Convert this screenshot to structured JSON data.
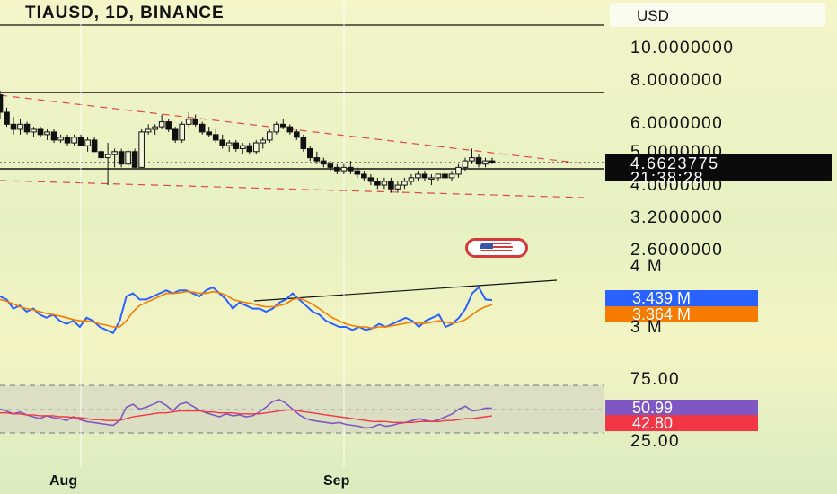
{
  "header": {
    "title": "TIAUSD, 1D, BINANCE",
    "currency": "USD"
  },
  "price_axis": {
    "ticks": [
      "10.0000000",
      "8.0000000",
      "6.0000000",
      "5.0000000",
      "4.0000000",
      "3.2000000",
      "2.6000000"
    ],
    "last_price": "4.6623775",
    "countdown": "21:38:28"
  },
  "volume_axis": {
    "ticks": [
      "4 M",
      "3 M"
    ],
    "tag1": "3.439 M",
    "tag2": "3.364 M"
  },
  "rsi_axis": {
    "ticks": [
      "75.00",
      "25.00"
    ],
    "tag1": "50.99",
    "tag2": "42.80"
  },
  "time_axis": {
    "labels": [
      "Aug",
      "Sep"
    ]
  },
  "colors": {
    "blue_series": "#2962ff",
    "orange_series": "#f57c00",
    "purple_series": "#7e57c2",
    "red_series": "#f23645",
    "channel": "#e04848"
  },
  "icons": {
    "flag_badge": "us-flag-icon"
  },
  "chart_data": [
    {
      "type": "candlestick",
      "title": "TIAUSD, 1D, BINANCE",
      "scale": "log",
      "ylim": [
        2.4,
        12
      ],
      "yticks": [
        10,
        8,
        6,
        5,
        4,
        3.2,
        2.6
      ],
      "last": 4.6623775,
      "candles": [
        [
          7.3,
          7.5,
          6.2,
          6.5
        ],
        [
          6.5,
          6.7,
          5.9,
          6.0
        ],
        [
          6.0,
          6.3,
          5.6,
          5.8
        ],
        [
          5.8,
          6.2,
          5.6,
          6.0
        ],
        [
          6.0,
          6.1,
          5.6,
          5.7
        ],
        [
          5.7,
          5.9,
          5.5,
          5.8
        ],
        [
          5.8,
          5.9,
          5.5,
          5.6
        ],
        [
          5.6,
          5.8,
          5.4,
          5.7
        ],
        [
          5.7,
          5.8,
          5.3,
          5.4
        ],
        [
          5.4,
          5.6,
          5.3,
          5.5
        ],
        [
          5.5,
          5.6,
          5.2,
          5.3
        ],
        [
          5.3,
          5.6,
          5.2,
          5.5
        ],
        [
          5.5,
          5.6,
          5.2,
          5.2
        ],
        [
          5.2,
          5.5,
          5.0,
          5.4
        ],
        [
          5.4,
          5.5,
          5.0,
          5.0
        ],
        [
          5.0,
          5.1,
          4.7,
          4.8
        ],
        [
          4.8,
          5.3,
          4.0,
          4.9
        ],
        [
          4.9,
          5.1,
          4.5,
          5.0
        ],
        [
          5.0,
          5.1,
          4.5,
          4.6
        ],
        [
          4.6,
          5.1,
          4.5,
          5.0
        ],
        [
          5.0,
          5.1,
          4.5,
          4.5
        ],
        [
          4.5,
          5.8,
          4.5,
          5.7
        ],
        [
          5.7,
          6.0,
          5.6,
          5.8
        ],
        [
          5.8,
          6.0,
          5.6,
          5.9
        ],
        [
          5.9,
          6.4,
          5.8,
          6.1
        ],
        [
          6.1,
          6.2,
          5.7,
          5.8
        ],
        [
          5.8,
          5.9,
          5.3,
          5.4
        ],
        [
          5.4,
          6.1,
          5.3,
          6.0
        ],
        [
          6.0,
          6.5,
          5.9,
          6.2
        ],
        [
          6.2,
          6.4,
          5.9,
          6.0
        ],
        [
          6.0,
          6.1,
          5.6,
          5.7
        ],
        [
          5.7,
          5.9,
          5.5,
          5.6
        ],
        [
          5.6,
          5.8,
          5.3,
          5.4
        ],
        [
          5.4,
          5.6,
          5.1,
          5.2
        ],
        [
          5.2,
          5.4,
          5.0,
          5.3
        ],
        [
          5.3,
          5.4,
          5.0,
          5.1
        ],
        [
          5.1,
          5.3,
          4.9,
          5.2
        ],
        [
          5.2,
          5.3,
          4.9,
          5.0
        ],
        [
          5.0,
          5.4,
          4.9,
          5.3
        ],
        [
          5.3,
          5.5,
          5.1,
          5.4
        ],
        [
          5.4,
          5.8,
          5.3,
          5.7
        ],
        [
          5.7,
          6.1,
          5.6,
          6.0
        ],
        [
          6.0,
          6.2,
          5.8,
          5.9
        ],
        [
          5.9,
          6.0,
          5.6,
          5.7
        ],
        [
          5.7,
          5.8,
          5.4,
          5.5
        ],
        [
          5.5,
          5.6,
          5.0,
          5.1
        ],
        [
          5.1,
          5.2,
          4.7,
          4.8
        ],
        [
          4.8,
          5.0,
          4.6,
          4.7
        ],
        [
          4.7,
          4.8,
          4.5,
          4.6
        ],
        [
          4.6,
          4.7,
          4.4,
          4.5
        ],
        [
          4.5,
          4.6,
          4.3,
          4.4
        ],
        [
          4.4,
          4.6,
          4.3,
          4.5
        ],
        [
          4.5,
          4.7,
          4.3,
          4.4
        ],
        [
          4.4,
          4.5,
          4.2,
          4.3
        ],
        [
          4.3,
          4.4,
          4.1,
          4.2
        ],
        [
          4.2,
          4.3,
          4.0,
          4.1
        ],
        [
          4.1,
          4.2,
          3.9,
          4.0
        ],
        [
          4.0,
          4.2,
          3.9,
          4.1
        ],
        [
          4.1,
          4.2,
          3.8,
          3.9
        ],
        [
          3.9,
          4.1,
          3.8,
          4.0
        ],
        [
          4.0,
          4.2,
          3.9,
          4.1
        ],
        [
          4.1,
          4.3,
          4.0,
          4.2
        ],
        [
          4.2,
          4.4,
          4.1,
          4.3
        ],
        [
          4.3,
          4.4,
          4.1,
          4.2
        ],
        [
          4.2,
          4.3,
          4.0,
          4.2
        ],
        [
          4.2,
          4.3,
          4.1,
          4.3
        ],
        [
          4.3,
          4.4,
          4.2,
          4.2
        ],
        [
          4.2,
          4.4,
          4.1,
          4.3
        ],
        [
          4.3,
          4.6,
          4.2,
          4.5
        ],
        [
          4.5,
          4.8,
          4.4,
          4.7
        ],
        [
          4.7,
          5.1,
          4.6,
          4.8
        ],
        [
          4.8,
          4.9,
          4.5,
          4.6
        ],
        [
          4.6,
          4.8,
          4.5,
          4.7
        ],
        [
          4.7,
          4.8,
          4.6,
          4.66
        ]
      ],
      "xlabels": [
        "Aug",
        "Sep"
      ]
    },
    {
      "type": "line",
      "panel": "volume oscillator",
      "yticks": [
        "4 M",
        "3 M"
      ],
      "series": [
        {
          "values": [
            3.5,
            3.45,
            3.3,
            3.35,
            3.25,
            3.3,
            3.2,
            3.15,
            3.2,
            3.1,
            3.05,
            3.1,
            3.0,
            3.15,
            3.1,
            3.0,
            2.95,
            2.9,
            3.1,
            3.5,
            3.55,
            3.45,
            3.45,
            3.5,
            3.55,
            3.6,
            3.55,
            3.6,
            3.6,
            3.55,
            3.5,
            3.6,
            3.65,
            3.55,
            3.45,
            3.3,
            3.4,
            3.35,
            3.3,
            3.3,
            3.25,
            3.3,
            3.4,
            3.45,
            3.55,
            3.45,
            3.35,
            3.25,
            3.2,
            3.1,
            3.05,
            3.0,
            3.0,
            2.95,
            3.0,
            2.95,
            2.98,
            3.05,
            3.0,
            3.05,
            3.1,
            3.15,
            3.1,
            3.0,
            3.1,
            3.15,
            3.2,
            3.0,
            3.05,
            3.15,
            3.3,
            3.55,
            3.65,
            3.45,
            3.44
          ],
          "last": 3.439
        },
        {
          "values": [
            3.45,
            3.42,
            3.38,
            3.33,
            3.3,
            3.28,
            3.25,
            3.22,
            3.2,
            3.18,
            3.15,
            3.12,
            3.1,
            3.1,
            3.08,
            3.05,
            3.03,
            3.0,
            3.0,
            3.1,
            3.25,
            3.35,
            3.4,
            3.45,
            3.5,
            3.55,
            3.55,
            3.56,
            3.58,
            3.57,
            3.55,
            3.55,
            3.58,
            3.56,
            3.52,
            3.45,
            3.42,
            3.4,
            3.38,
            3.35,
            3.33,
            3.33,
            3.35,
            3.38,
            3.45,
            3.47,
            3.43,
            3.37,
            3.3,
            3.22,
            3.15,
            3.1,
            3.05,
            3.02,
            3.0,
            3.0,
            2.98,
            3.0,
            3.0,
            3.02,
            3.04,
            3.06,
            3.08,
            3.06,
            3.06,
            3.08,
            3.1,
            3.08,
            3.06,
            3.08,
            3.12,
            3.2,
            3.28,
            3.33,
            3.364
          ],
          "last": 3.364
        }
      ]
    },
    {
      "type": "line",
      "panel": "RSI",
      "yticks": [
        "75.00",
        "25.00"
      ],
      "ylim": [
        0,
        100
      ],
      "series": [
        {
          "values": [
            50,
            48,
            45,
            47,
            44,
            42,
            40,
            43,
            41,
            40,
            38,
            42,
            39,
            37,
            36,
            35,
            34,
            33,
            38,
            52,
            55,
            50,
            52,
            55,
            58,
            54,
            48,
            55,
            57,
            53,
            49,
            46,
            44,
            42,
            45,
            43,
            44,
            42,
            43,
            47,
            52,
            58,
            60,
            56,
            50,
            44,
            40,
            38,
            37,
            36,
            35,
            36,
            34,
            33,
            32,
            30,
            31,
            34,
            32,
            33,
            35,
            36,
            38,
            40,
            38,
            37,
            39,
            42,
            45,
            50,
            53,
            48,
            49,
            51,
            50.99
          ],
          "last": 50.99
        },
        {
          "values": [
            46,
            46,
            45,
            45,
            44,
            44,
            43,
            43,
            43,
            42,
            42,
            41,
            41,
            40,
            39,
            39,
            38,
            38,
            38,
            40,
            42,
            43,
            44,
            45,
            46,
            46,
            47,
            48,
            48,
            48,
            48,
            47,
            47,
            46,
            46,
            46,
            45,
            45,
            45,
            45,
            46,
            47,
            48,
            49,
            49,
            48,
            47,
            46,
            45,
            44,
            43,
            42,
            41,
            40,
            39,
            38,
            37,
            37,
            37,
            36,
            36,
            36,
            36,
            37,
            37,
            37,
            37,
            38,
            38,
            39,
            40,
            40,
            41,
            42,
            42.8
          ],
          "last": 42.8
        }
      ]
    }
  ]
}
